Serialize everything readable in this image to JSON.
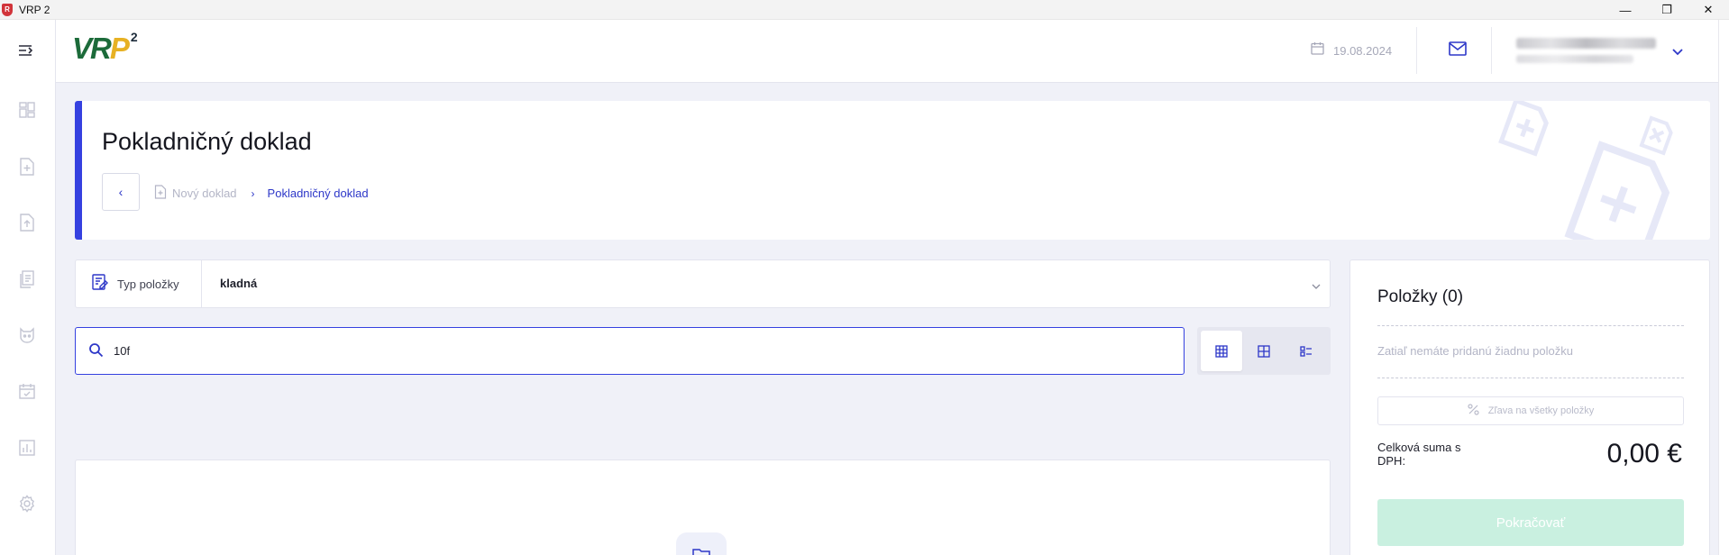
{
  "window": {
    "title": "VRP 2",
    "icon_letter": "R",
    "minimize": "—",
    "restore": "❐",
    "close": "✕"
  },
  "header": {
    "logo_part1": "VR",
    "logo_part2": "P",
    "logo_sup": "2",
    "date": "19.08.2024"
  },
  "sidebar": {
    "items": [
      "toggle-menu",
      "dashboard",
      "new-document",
      "upload-document",
      "documents",
      "products",
      "calendar",
      "reports",
      "settings"
    ]
  },
  "page": {
    "title": "Pokladničný doklad",
    "back_label": "‹",
    "breadcrumb": {
      "parent": "Nový doklad",
      "separator": "›",
      "current": "Pokladničný doklad"
    }
  },
  "item_type": {
    "label": "Typ položky",
    "value": "kladná"
  },
  "search": {
    "value": "10f",
    "placeholder": ""
  },
  "items_panel": {
    "title": "Položky (0)",
    "empty_message": "Zatiaľ nemáte pridanú žiadnu položku",
    "discount_label": "Zľava na všetky položky",
    "total_label": "Celková suma s DPH:",
    "total_value": "0,00 €",
    "continue_label": "Pokračovať"
  },
  "colors": {
    "accent": "#3541e0",
    "continue_disabled": "#c9f0e0",
    "logo_green": "#1c6b3a",
    "logo_yellow": "#e7b123"
  }
}
